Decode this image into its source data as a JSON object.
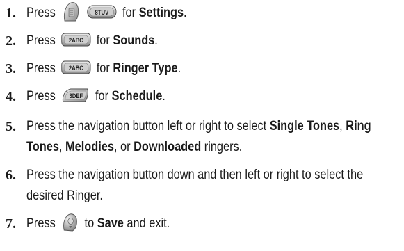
{
  "steps": [
    {
      "num": "1.",
      "press": "Press",
      "keys": [
        "menu-key-icon",
        "8tuv-key-icon"
      ],
      "key_labels": [
        "",
        "8TUV"
      ],
      "for_text": "for",
      "bold": "Settings",
      "end": "."
    },
    {
      "num": "2.",
      "press": "Press",
      "keys": [
        "2abc-key-icon"
      ],
      "key_labels": [
        "2ABC"
      ],
      "for_text": "for",
      "bold": "Sounds",
      "end": "."
    },
    {
      "num": "3.",
      "press": "Press",
      "keys": [
        "2abc-key-icon"
      ],
      "key_labels": [
        "2ABC"
      ],
      "for_text": "for",
      "bold": "Ringer Type",
      "end": "."
    },
    {
      "num": "4.",
      "press": "Press",
      "keys": [
        "3def-key-icon"
      ],
      "key_labels": [
        "3DEF"
      ],
      "for_text": "for",
      "bold": "Schedule",
      "end": "."
    },
    {
      "num": "5.",
      "text_a": "Press the navigation button left or right to select ",
      "b1": "Single Tones",
      "s1": ", ",
      "b2": "Ring Tones",
      "s2": ", ",
      "b3": "Melodies",
      "s3": ", or ",
      "b4": "Downloaded",
      "s4": " ringers."
    },
    {
      "num": "6.",
      "text": "Press the navigation button down and then left or right to select the desired Ringer."
    },
    {
      "num": "7.",
      "press": "Press",
      "keys": [
        "ok-key-icon"
      ],
      "key_labels": [
        ""
      ],
      "to_text": "to",
      "bold": "Save",
      "end": "and exit."
    }
  ]
}
